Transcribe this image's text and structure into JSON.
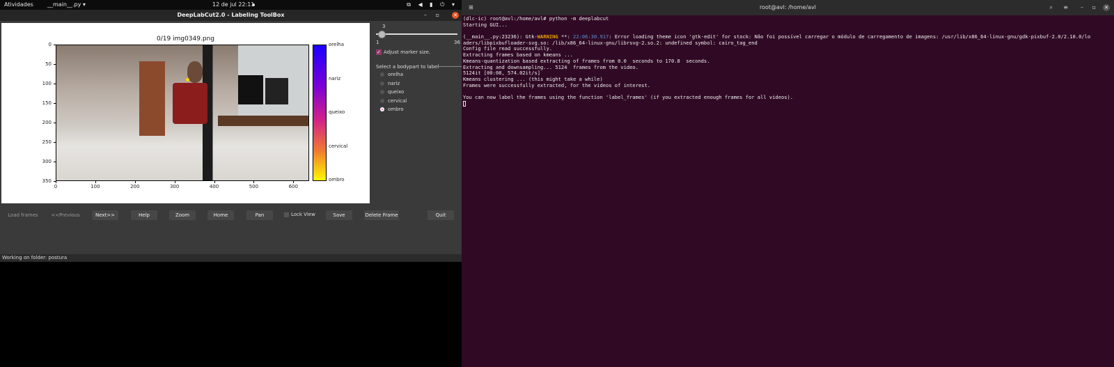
{
  "topbar": {
    "activities": "Atividades",
    "app_menu": "__main__.py ▾",
    "clock": "12 de jul  22:11",
    "tray": "⧉ ◀ ▮ ⏻ ▾"
  },
  "dlc_window": {
    "title": "DeepLabCut2.0 - Labeling ToolBox",
    "plot": {
      "title": "0/19 img0349.png",
      "y_ticks": [
        "0",
        "50",
        "100",
        "150",
        "200",
        "250",
        "300",
        "350"
      ],
      "x_ticks": [
        "0",
        "100",
        "200",
        "300",
        "400",
        "500",
        "600"
      ],
      "colorbar_labels": [
        "orelha",
        "nariz",
        "queixo",
        "cervical",
        "ombro"
      ]
    },
    "marker_slider": {
      "value": "3",
      "min": "1",
      "max": "36",
      "fraction": 0.057
    },
    "adjust_marker": {
      "label": "Adjust marker size.",
      "checked": true
    },
    "bodypart_group": {
      "legend": "Select a bodypart to label",
      "items": [
        {
          "label": "orelha",
          "selected": false
        },
        {
          "label": "nariz",
          "selected": false
        },
        {
          "label": "queixo",
          "selected": false
        },
        {
          "label": "cervical",
          "selected": false
        },
        {
          "label": "ombro",
          "selected": true
        }
      ]
    },
    "buttons": {
      "load_frames": "Load frames",
      "previous": "<<Previous",
      "next": "Next>>",
      "help": "Help",
      "zoom": "Zoom",
      "home": "Home",
      "pan": "Pan",
      "lock_view": "Lock View",
      "save": "Save",
      "delete_frame": "Delete Frame",
      "quit": "Quit"
    },
    "status": "Working on folder: postura"
  },
  "terminal": {
    "title": "root@avl: /home/avl",
    "lines": [
      {
        "text": "(dlc-ic) root@avl:/home/avl# python -m deeplabcut"
      },
      {
        "text": "Starting GUI..."
      },
      {
        "text": ""
      },
      {
        "pre": "(__main__.py:23236): Gtk-",
        "warn": "WARNING",
        "mid": " **: ",
        "time": "22:06:30.917",
        "post": ": Error loading theme icon 'gtk-edit' for stock: Não foi possível carregar o módulo de carregamento de imagens: /usr/lib/x86_64-linux-gnu/gdk-pixbuf-2.0/2.10.0/lo"
      },
      {
        "text": "aders/libpixbufloader-svg.so: /lib/x86_64-linux-gnu/librsvg-2.so.2: undefined symbol: cairo_tag_end"
      },
      {
        "text": "Config file read successfully."
      },
      {
        "text": "Extracting frames based on kmeans ..."
      },
      {
        "text": "Kmeans-quantization based extracting of frames from 0.0  seconds to 170.8  seconds."
      },
      {
        "text": "Extracting and downsampling... 5124  frames from the video."
      },
      {
        "text": "5124it [00:08, 574.02it/s]"
      },
      {
        "text": "Kmeans clustering ... (this might take a while)"
      },
      {
        "text": "Frames were successfully extracted, for the videos of interest."
      },
      {
        "text": ""
      },
      {
        "text": "You can now label the frames using the function 'label_frames' (if you extracted enough frames for all videos)."
      }
    ]
  }
}
